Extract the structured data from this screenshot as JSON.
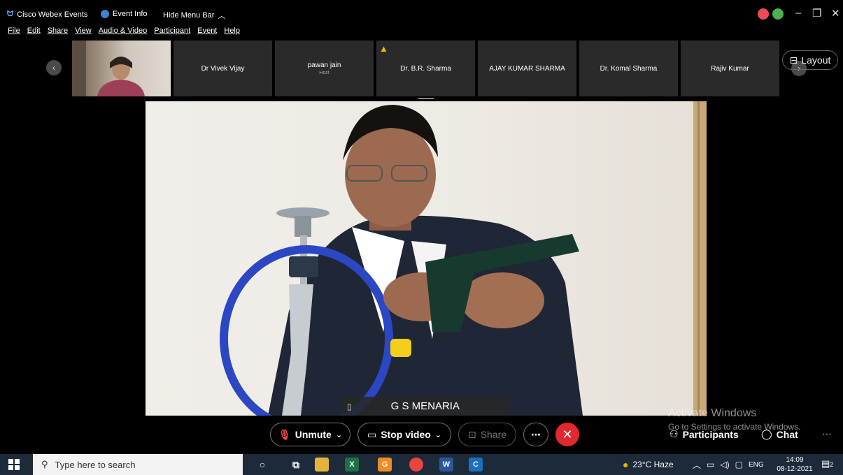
{
  "titlebar": {
    "app_name": "Cisco Webex Events",
    "event_info": "Event Info",
    "hide_menu": "Hide Menu Bar"
  },
  "menu": [
    "File",
    "Edit",
    "Share",
    "View",
    "Audio & Video",
    "Participant",
    "Event",
    "Help"
  ],
  "participants": [
    {
      "name": "Dr Vivek Vijay",
      "sub": ""
    },
    {
      "name": "pawan jain",
      "sub": "Host"
    },
    {
      "name": "Dr. B.R. Sharma",
      "sub": ""
    },
    {
      "name": "AJAY KUMAR SHARMA",
      "sub": ""
    },
    {
      "name": "Dr. Komal Sharma",
      "sub": ""
    },
    {
      "name": "Rajiv Kumar",
      "sub": ""
    }
  ],
  "layout_label": "Layout",
  "speaker_name": "G S MENARIA",
  "watermark": {
    "title": "Activate Windows",
    "subtitle": "Go to Settings to activate Windows."
  },
  "controls": {
    "unmute": "Unmute",
    "stop_video": "Stop video",
    "share": "Share",
    "participants": "Participants",
    "chat": "Chat"
  },
  "taskbar": {
    "search_placeholder": "Type here to search",
    "weather": "23°C  Haze",
    "lang": "ENG",
    "time": "14:09",
    "date": "08-12-2021",
    "notifications": "2"
  },
  "colors": {
    "end_call": "#e0282e",
    "taskbar": "#1c2a3a"
  }
}
